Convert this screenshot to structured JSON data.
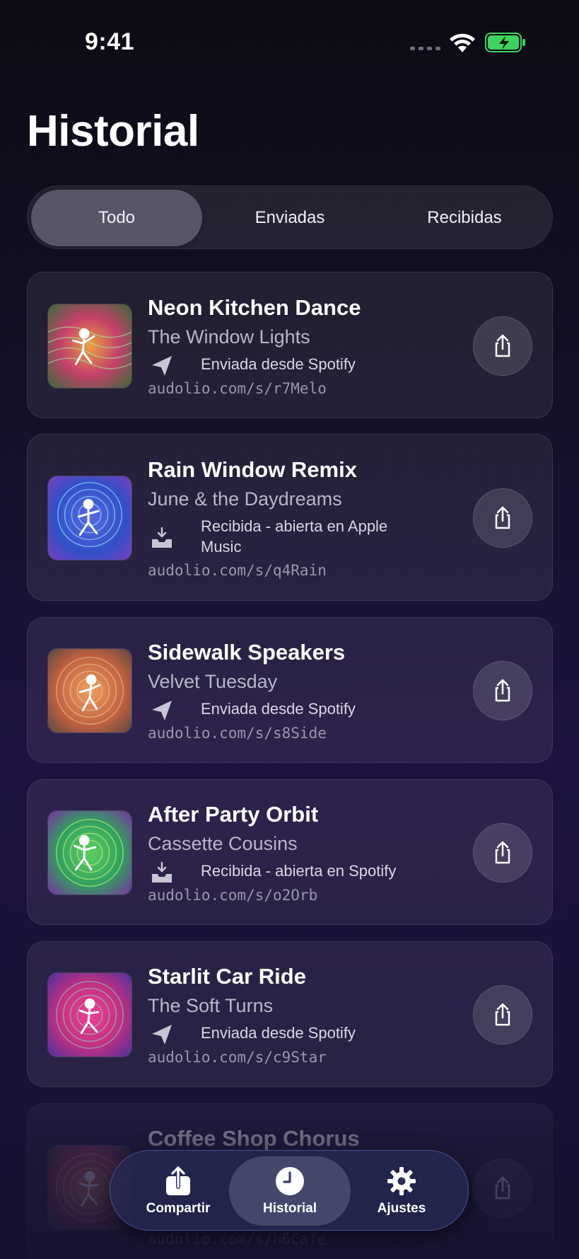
{
  "status_bar": {
    "time": "9:41"
  },
  "page_title": "Historial",
  "segments": [
    "Todo",
    "Enviadas",
    "Recibidas"
  ],
  "history": [
    {
      "title": "Neon Kitchen Dance",
      "artist": "The Window Lights",
      "status": "Enviada desde Spotify",
      "status_icon": "send-icon",
      "link": "audolio.com/s/r7Melo"
    },
    {
      "title": "Rain Window Remix",
      "artist": "June & the Daydreams",
      "status": "Recibida - abierta en Apple Music",
      "status_icon": "inbox-icon",
      "link": "audolio.com/s/q4Rain"
    },
    {
      "title": "Sidewalk Speakers",
      "artist": "Velvet Tuesday",
      "status": "Enviada desde Spotify",
      "status_icon": "send-icon",
      "link": "audolio.com/s/s8Side"
    },
    {
      "title": "After Party Orbit",
      "artist": "Cassette Cousins",
      "status": "Recibida - abierta en Spotify",
      "status_icon": "inbox-icon",
      "link": "audolio.com/s/o2Orb"
    },
    {
      "title": "Starlit Car Ride",
      "artist": "The Soft Turns",
      "status": "Enviada desde Spotify",
      "status_icon": "send-icon",
      "link": "audolio.com/s/c9Star"
    },
    {
      "title": "Coffee Shop Chorus",
      "artist": "",
      "status": "",
      "status_icon": "",
      "link": "audolio.com/s/h6Cafe"
    }
  ],
  "tab_bar": [
    {
      "label": "Compartir",
      "icon": "share-icon"
    },
    {
      "label": "Historial",
      "icon": "clock-icon"
    },
    {
      "label": "Ajustes",
      "icon": "gear-icon"
    }
  ],
  "colors": {
    "accent_battery": "#3fd260",
    "background": "#15112a"
  }
}
